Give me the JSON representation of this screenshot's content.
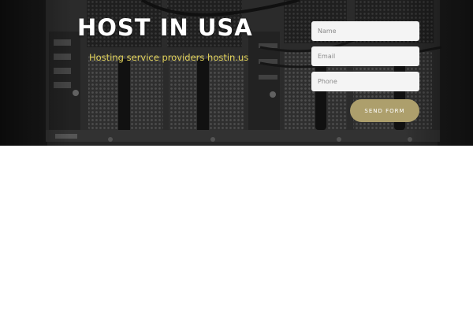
{
  "hero": {
    "title": "HOST IN USA",
    "tagline": "Hosting service providers hostin.us",
    "background": "server-rack-photo"
  },
  "form": {
    "name_placeholder": "Name",
    "email_placeholder": "Email",
    "phone_placeholder": "Phone",
    "submit_label": "SEND FORM"
  },
  "colors": {
    "tagline": "#e3d35a",
    "button": "#ad9f6c",
    "field": "#f4f4f4",
    "hero_bg": "#2b2b2b"
  }
}
